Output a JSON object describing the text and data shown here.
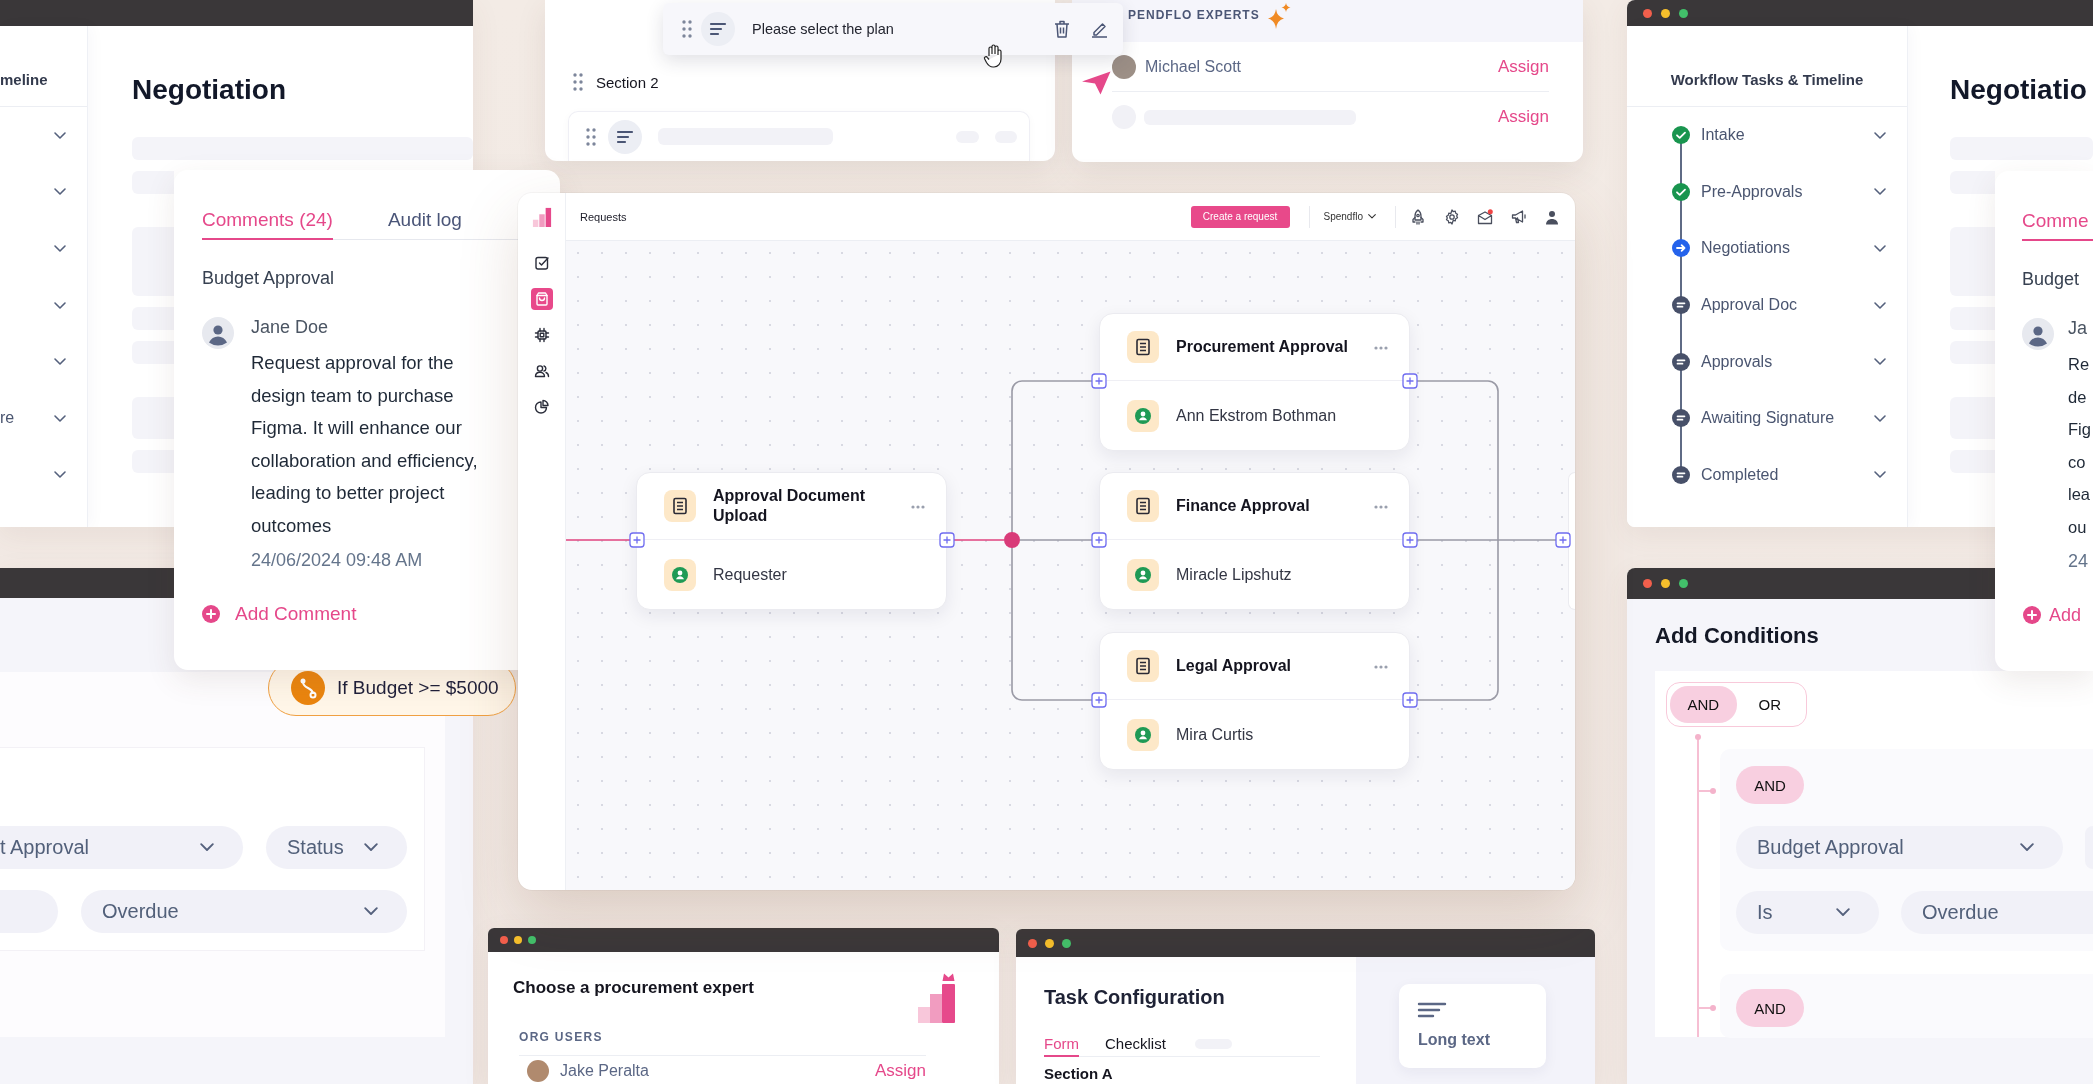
{
  "left_workflow_window": {
    "sidebar_title": "meline",
    "steps": [
      {
        "expanded": false
      },
      {
        "expanded": false
      },
      {
        "expanded": false
      },
      {
        "expanded": false
      },
      {
        "expanded": false
      },
      {
        "label": "re",
        "expanded": false
      },
      {
        "expanded": false
      }
    ],
    "heading": "Negotiation"
  },
  "comments_panel": {
    "tabs": [
      {
        "label": "Comments (24)",
        "selected": true
      },
      {
        "label": "Audit log",
        "selected": false
      }
    ],
    "topic": "Budget Approval",
    "comment": {
      "author": "Jane Doe",
      "text": "Request approval for the design team to purchase Figma. It will enhance our collaboration and efficiency, leading to better project outcomes",
      "timestamp": "24/06/2024 09:48 AM"
    },
    "add_action": "Add Comment"
  },
  "condition_chip": {
    "text": "If Budget >= $5000"
  },
  "left_conditions_window": {
    "rows": [
      [
        {
          "value": "t Approval",
          "dropdown": true
        },
        {
          "value": "Status",
          "dropdown": true
        }
      ],
      [
        {
          "dropdown": false
        },
        {
          "value": "Overdue",
          "dropdown": true
        }
      ]
    ]
  },
  "form_builder": {
    "dragged_field": {
      "label": "Please select the plan"
    },
    "section": {
      "title": "Section 2"
    }
  },
  "experts_card": {
    "header": "PENDFLO EXPERTS",
    "experts": [
      {
        "name": "Michael Scott",
        "action": "Assign"
      },
      {
        "action": "Assign"
      }
    ]
  },
  "app_window": {
    "header": {
      "page_title": "Requests",
      "primary_button": "Create a request",
      "workspace": "Spendflo",
      "unread_inbox": true
    },
    "nav": [
      {
        "selected": false
      },
      {
        "selected": true
      },
      {
        "selected": false
      },
      {
        "selected": false
      },
      {
        "selected": false
      }
    ],
    "workflow": {
      "nodes": [
        {
          "title": "Approval Document Upload",
          "assignee": "Requester"
        },
        {
          "title": "Procurement Approval",
          "assignee": "Ann Ekstrom Bothman"
        },
        {
          "title": "Finance Approval",
          "assignee": "Miracle Lipshutz"
        },
        {
          "title": "Legal Approval",
          "assignee": "Mira Curtis"
        }
      ]
    }
  },
  "right_workflow_window": {
    "sidebar_title": "Workflow Tasks & Timeline",
    "steps": [
      {
        "label": "Intake",
        "completed": true,
        "current": false,
        "expanded": false
      },
      {
        "label": "Pre-Approvals",
        "completed": true,
        "current": false,
        "expanded": false
      },
      {
        "label": "Negotiations",
        "completed": false,
        "current": true,
        "expanded": false
      },
      {
        "label": "Approval Doc",
        "completed": false,
        "current": false,
        "expanded": false
      },
      {
        "label": "Approvals",
        "completed": false,
        "current": false,
        "expanded": false
      },
      {
        "label": "Awaiting Signature",
        "completed": false,
        "current": false,
        "expanded": false
      },
      {
        "label": "Completed",
        "completed": false,
        "current": false,
        "expanded": false
      }
    ],
    "heading": "Negotiatio"
  },
  "right_comments_panel": {
    "tabs": [
      {
        "label": "Comme",
        "selected": true
      }
    ],
    "topic": "Budget",
    "comment": {
      "author": "Ja",
      "lines": [
        "Re",
        "de",
        "Fig",
        "co",
        "lea",
        "ou"
      ],
      "timestamp": "24"
    },
    "add_action": "Add"
  },
  "conditions_window": {
    "title": "Add Conditions",
    "operators": [
      {
        "label": "AND",
        "selected": true
      },
      {
        "label": "OR",
        "selected": false
      }
    ],
    "groups": [
      {
        "operator": "AND",
        "rows": [
          [
            {
              "value": "Budget Approval",
              "dropdown": true
            },
            {
              "dropdown": false
            }
          ],
          [
            {
              "value": "Is",
              "dropdown": true
            },
            {
              "value": "Overdue",
              "dropdown": false
            }
          ]
        ]
      },
      {
        "operator": "AND"
      }
    ]
  },
  "expert_picker_window": {
    "title": "Choose a procurement expert",
    "section_label": "ORG USERS",
    "users": [
      {
        "name": "Jake Peralta",
        "action": "Assign"
      }
    ]
  },
  "task_config_window": {
    "title": "Task Configuration",
    "tabs": [
      {
        "label": "Form",
        "selected": true
      },
      {
        "label": "Checklist",
        "selected": false
      }
    ],
    "section_title": "Section A",
    "field_types": [
      {
        "label": "Long text"
      }
    ]
  }
}
